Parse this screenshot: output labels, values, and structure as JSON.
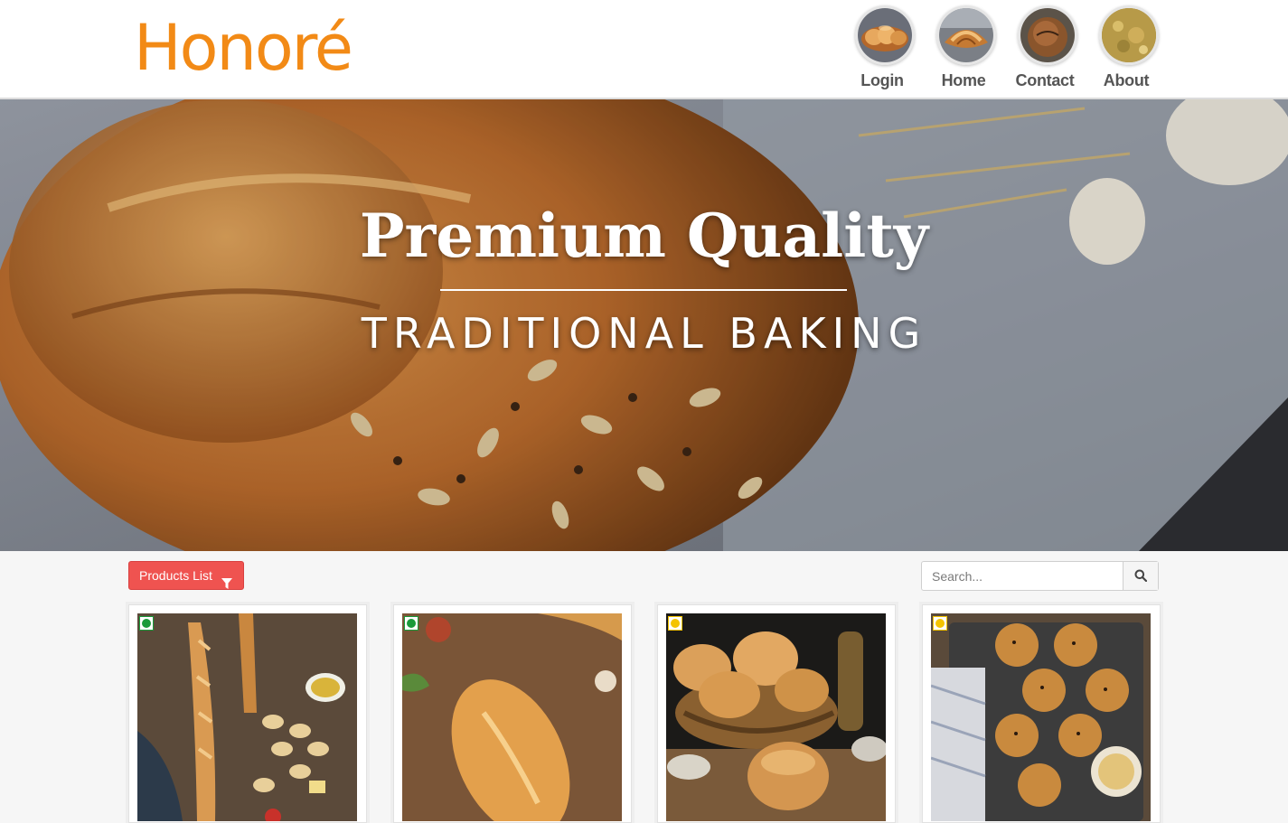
{
  "brand": {
    "name": "Honoré",
    "color": "#f28a16"
  },
  "nav": {
    "items": [
      {
        "label": "Login",
        "icon": "bread-rolls-icon"
      },
      {
        "label": "Home",
        "icon": "croissant-icon"
      },
      {
        "label": "Contact",
        "icon": "round-loaf-icon"
      },
      {
        "label": "About",
        "icon": "crumble-icon"
      }
    ]
  },
  "hero": {
    "title": "Premium Quality",
    "subtitle": "TRADITIONAL BAKING"
  },
  "toolbar": {
    "products_label": "Products List",
    "products_icon": "filter-icon",
    "products_color": "#ef5350",
    "search_placeholder": "Search...",
    "search_icon": "search-icon"
  },
  "products": [
    {
      "image": "baguettes-photo",
      "diet_marker": "veg",
      "marker_color": "#1a9a3a"
    },
    {
      "image": "bread-loaf-photo",
      "diet_marker": "veg",
      "marker_color": "#1a9a3a"
    },
    {
      "image": "seeded-buns-photo",
      "diet_marker": "egg",
      "marker_color": "#f4c400"
    },
    {
      "image": "buns-tray-photo",
      "diet_marker": "egg",
      "marker_color": "#f4c400"
    }
  ]
}
